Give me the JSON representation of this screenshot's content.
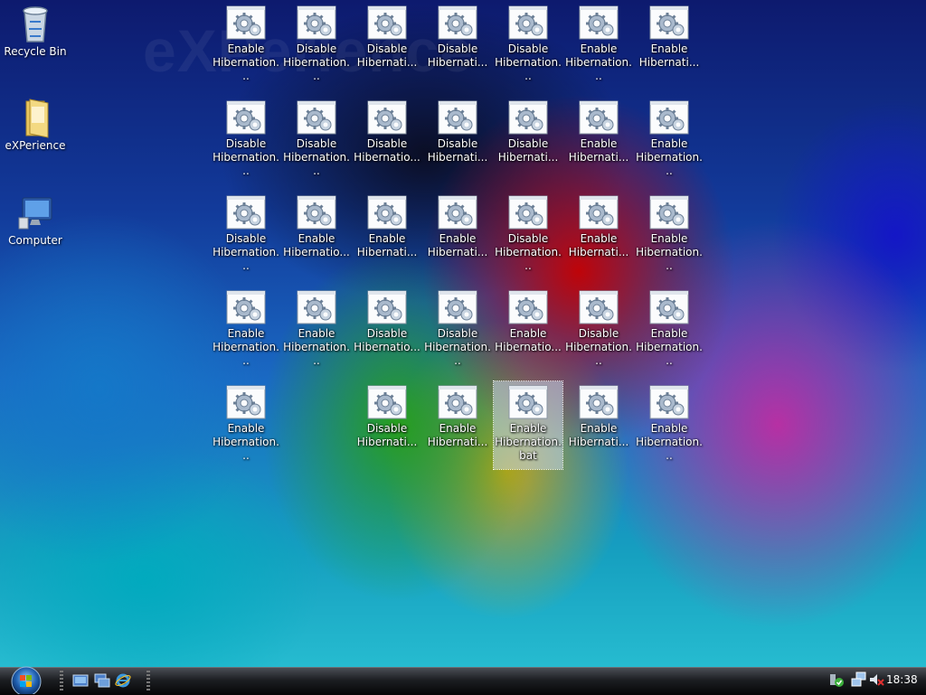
{
  "watermark": "eXPerience",
  "left_icons": [
    {
      "label": "Recycle Bin",
      "icon": "recycle-bin-icon"
    },
    {
      "label": "eXPerience",
      "icon": "folder-icon"
    },
    {
      "label": "Computer",
      "icon": "computer-icon"
    }
  ],
  "grid_icons": [
    [
      "Enable Hibernation...",
      "Disable Hibernation...",
      "Disable Hibernati...",
      "Disable Hibernati...",
      "Disable Hibernation...",
      "Enable Hibernation...",
      "Enable Hibernati..."
    ],
    [
      "Disable Hibernation...",
      "Disable Hibernation...",
      "Disable Hibernatio...",
      "Disable Hibernati...",
      "Disable Hibernati...",
      "Enable Hibernati...",
      "Enable Hibernation..."
    ],
    [
      "Disable Hibernation...",
      "Enable Hibernatio...",
      "Enable Hibernati...",
      "Enable Hibernati...",
      "Disable Hibernation...",
      "Enable Hibernati...",
      "Enable Hibernation..."
    ],
    [
      "Enable Hibernation...",
      "Enable Hibernation...",
      "Disable Hibernatio...",
      "Disable Hibernation...",
      "Enable Hibernatio...",
      "Disable Hibernation...",
      "Enable Hibernation..."
    ],
    [
      "Enable Hibernation...",
      null,
      "Disable Hibernati...",
      "Enable Hibernati...",
      "Enable Hibernation.bat",
      "Enable Hibernati...",
      "Enable Hibernation..."
    ]
  ],
  "selected_icon_label": "Enable Hibernation.bat",
  "taskbar": {
    "clock": "18:38",
    "quick_launch": [
      "show-desktop-icon",
      "switch-windows-icon",
      "internet-explorer-icon"
    ],
    "tray": [
      "update-icon",
      "network-icon",
      "volume-muted-icon"
    ]
  }
}
